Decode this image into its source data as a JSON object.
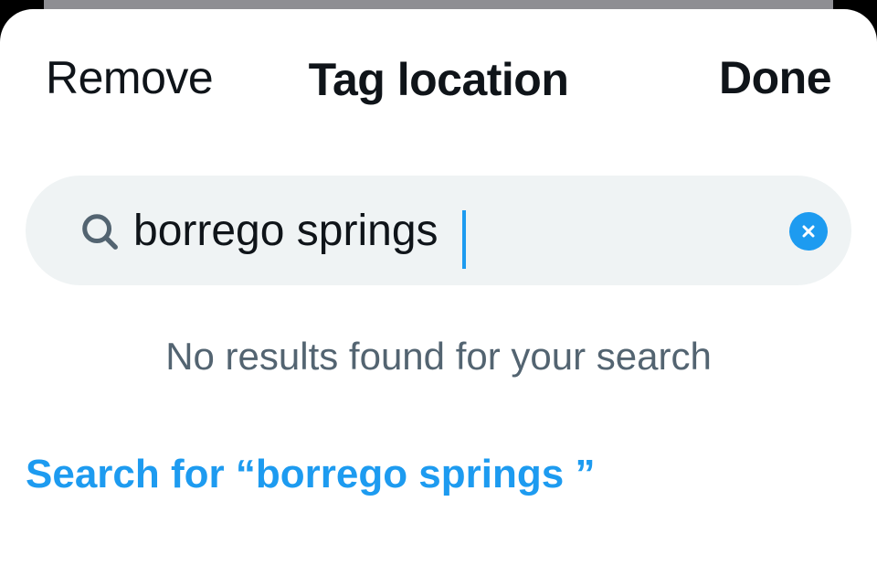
{
  "header": {
    "remove_label": "Remove",
    "title": "Tag location",
    "done_label": "Done"
  },
  "search": {
    "value": "borrego springs",
    "icon": "search-icon",
    "clear_icon": "clear-icon"
  },
  "results": {
    "empty_message": "No results found for your search",
    "search_for_label": "Search for “borrego springs ”"
  },
  "colors": {
    "accent": "#1d9bf0",
    "text_primary": "#0f1419",
    "text_secondary": "#536471",
    "search_bg": "#eff3f4"
  }
}
